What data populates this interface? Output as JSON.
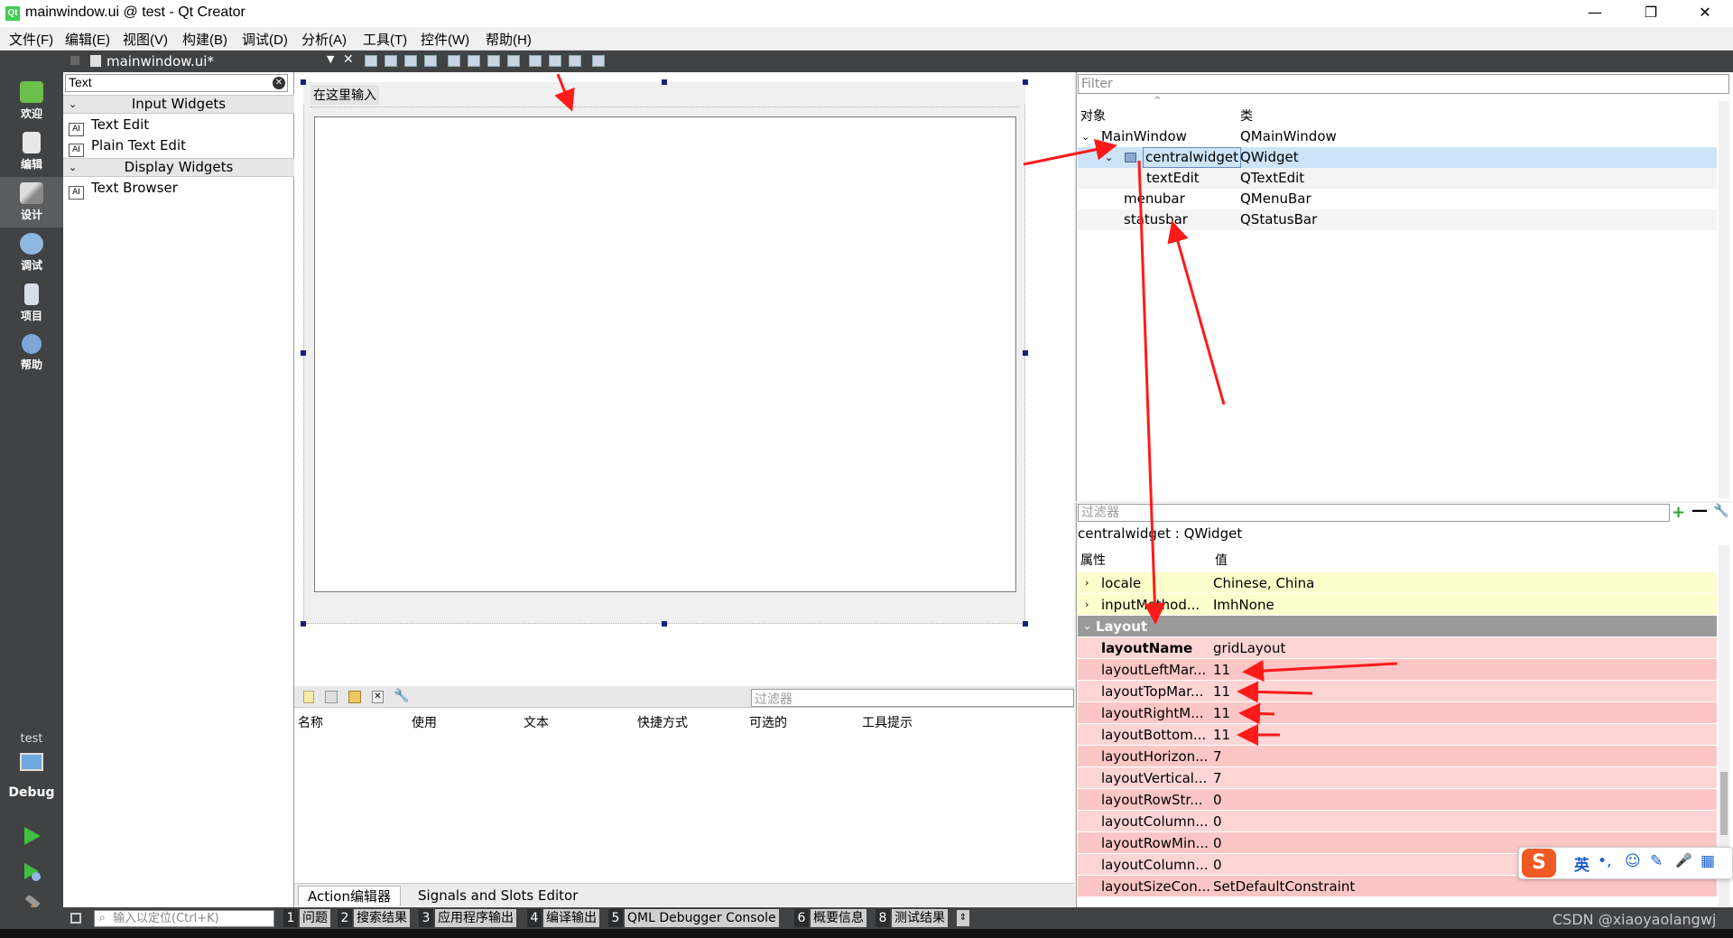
{
  "window": {
    "title": "mainwindow.ui @ test - Qt Creator",
    "app_icon": "Qt",
    "minimize": "—",
    "maximize": "❐",
    "close": "✕"
  },
  "menu": [
    "文件(F)",
    "编辑(E)",
    "视图(V)",
    "构建(B)",
    "调试(D)",
    "分析(A)",
    "工具(T)",
    "控件(W)",
    "帮助(H)"
  ],
  "modes": [
    {
      "label": "欢迎",
      "icon": "qt-welcome-icon"
    },
    {
      "label": "编辑",
      "icon": "edit-icon"
    },
    {
      "label": "设计",
      "icon": "design-icon"
    },
    {
      "label": "调试",
      "icon": "debug-icon"
    },
    {
      "label": "项目",
      "icon": "project-icon"
    },
    {
      "label": "帮助",
      "icon": "help-icon"
    }
  ],
  "kit": {
    "project": "test",
    "config": "Debug"
  },
  "editor": {
    "document": "mainwindow.ui*"
  },
  "widget_box": {
    "filter": "Text",
    "categories": [
      {
        "name": "Input Widgets",
        "items": [
          "Text Edit",
          "Plain Text Edit"
        ]
      },
      {
        "name": "Display Widgets",
        "items": [
          "Text Browser"
        ]
      }
    ]
  },
  "form": {
    "menu_placeholder": "在这里输入"
  },
  "action_editor": {
    "filter_placeholder": "过滤器",
    "columns": [
      "名称",
      "使用",
      "文本",
      "快捷方式",
      "可选的",
      "工具提示"
    ],
    "tabs": [
      "Action编辑器",
      "Signals and Slots Editor"
    ]
  },
  "object_inspector": {
    "filter_placeholder": "Filter",
    "headers": [
      "对象",
      "类"
    ],
    "rows": [
      {
        "object": "MainWindow",
        "class": "QMainWindow"
      },
      {
        "object": "centralwidget",
        "class": "QWidget"
      },
      {
        "object": "textEdit",
        "class": "QTextEdit"
      },
      {
        "object": "menubar",
        "class": "QMenuBar"
      },
      {
        "object": "statusbar",
        "class": "QStatusBar"
      }
    ]
  },
  "property_editor": {
    "filter_placeholder": "过滤器",
    "class_line": "centralwidget : QWidget",
    "headers": [
      "属性",
      "值"
    ],
    "rows": [
      {
        "name": "locale",
        "value": "Chinese, China"
      },
      {
        "name": "inputMethod...",
        "value": "ImhNone"
      },
      {
        "name": "Layout",
        "value": ""
      },
      {
        "name": "layoutName",
        "value": "gridLayout"
      },
      {
        "name": "layoutLeftMar...",
        "value": "11"
      },
      {
        "name": "layoutTopMar...",
        "value": "11"
      },
      {
        "name": "layoutRightM...",
        "value": "11"
      },
      {
        "name": "layoutBottom...",
        "value": "11"
      },
      {
        "name": "layoutHorizon...",
        "value": "7"
      },
      {
        "name": "layoutVertical...",
        "value": "7"
      },
      {
        "name": "layoutRowStr...",
        "value": "0"
      },
      {
        "name": "layoutColumn...",
        "value": "0"
      },
      {
        "name": "layoutRowMin...",
        "value": "0"
      },
      {
        "name": "layoutColumn...",
        "value": "0"
      },
      {
        "name": "layoutSizeCon...",
        "value": "SetDefaultConstraint"
      }
    ]
  },
  "status_bar": {
    "locator_placeholder": "输入以定位(Ctrl+K)",
    "panes": [
      {
        "n": "1",
        "label": "问题"
      },
      {
        "n": "2",
        "label": "搜索结果"
      },
      {
        "n": "3",
        "label": "应用程序输出"
      },
      {
        "n": "4",
        "label": "编译输出"
      },
      {
        "n": "5",
        "label": "QML Debugger Console"
      },
      {
        "n": "6",
        "label": "概要信息"
      },
      {
        "n": "8",
        "label": "测试结果"
      }
    ]
  },
  "ime": {
    "logo": "S",
    "items": [
      "英",
      "•,",
      "☺",
      "✎",
      "🎤",
      "▦"
    ]
  },
  "watermark": "CSDN @xiaoyaolangwj",
  "colors": {
    "modebar": "#404244",
    "selection": "#cde3f7",
    "layout_row": "#fdd5d5",
    "arrow": "#ff1a1a",
    "ime_logo": "#f05a24"
  }
}
